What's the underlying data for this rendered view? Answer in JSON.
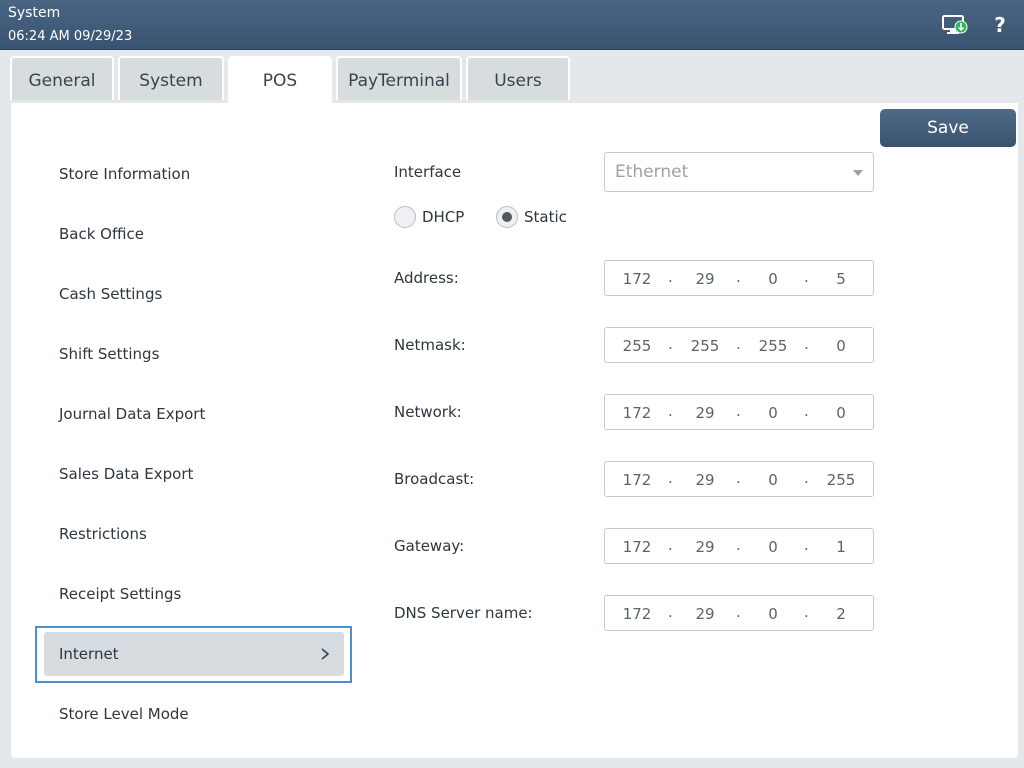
{
  "header": {
    "title": "System",
    "datetime": "06:24 AM 09/29/23",
    "help_label": "?"
  },
  "tabs": [
    {
      "label": "General"
    },
    {
      "label": "System"
    },
    {
      "label": "POS"
    },
    {
      "label": "PayTerminal"
    },
    {
      "label": "Users"
    }
  ],
  "active_tab": "POS",
  "toolbar": {
    "save_label": "Save"
  },
  "menu": {
    "items": [
      {
        "label": "Store Information"
      },
      {
        "label": "Back Office"
      },
      {
        "label": "Cash Settings"
      },
      {
        "label": "Shift Settings"
      },
      {
        "label": "Journal Data Export"
      },
      {
        "label": "Sales Data Export"
      },
      {
        "label": "Restrictions"
      },
      {
        "label": "Receipt Settings"
      },
      {
        "label": "Internet"
      },
      {
        "label": "Store Level Mode"
      }
    ],
    "active": "Internet"
  },
  "form": {
    "interface_label": "Interface",
    "interface_value": "Ethernet",
    "mode_options": [
      {
        "label": "DHCP",
        "selected": false
      },
      {
        "label": "Static",
        "selected": true
      }
    ],
    "fields": [
      {
        "label": "Address:",
        "octets": [
          "172",
          "29",
          "0",
          "5"
        ]
      },
      {
        "label": "Netmask:",
        "octets": [
          "255",
          "255",
          "255",
          "0"
        ]
      },
      {
        "label": "Network:",
        "octets": [
          "172",
          "29",
          "0",
          "0"
        ]
      },
      {
        "label": "Broadcast:",
        "octets": [
          "172",
          "29",
          "0",
          "255"
        ]
      },
      {
        "label": "Gateway:",
        "octets": [
          "172",
          "29",
          "0",
          "1"
        ]
      },
      {
        "label": "DNS Server name:",
        "octets": [
          "172",
          "29",
          "0",
          "2"
        ]
      }
    ],
    "separator": "."
  },
  "colors": {
    "header_bg": "#3e5a78",
    "accent_frame": "#4a8fd0",
    "status_badge": "#2fb55a"
  },
  "icons": {
    "monitor": "monitor-status-icon",
    "chevron": "chevron-right-icon"
  }
}
